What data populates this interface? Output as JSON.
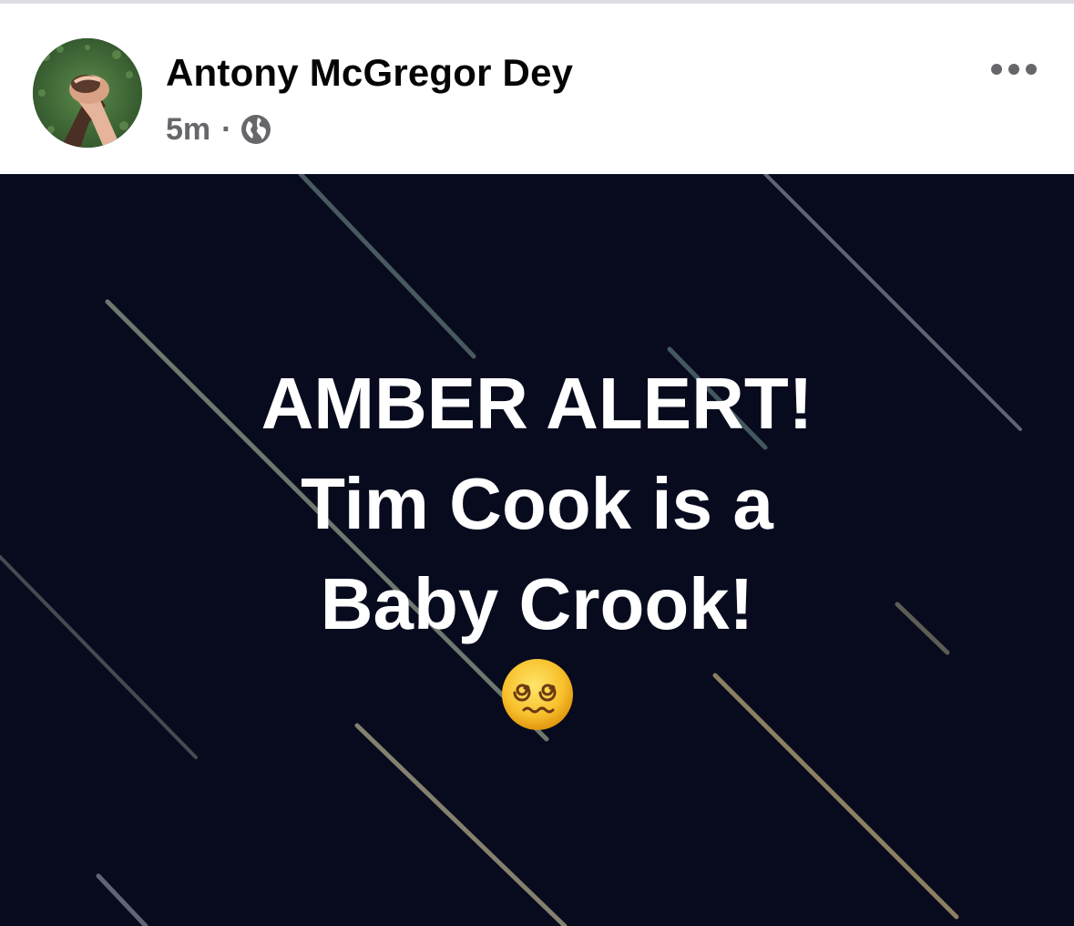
{
  "post": {
    "author": "Antony McGregor Dey",
    "timestamp": "5m",
    "separator": "·",
    "audience_icon": "globe-icon",
    "more_icon": "more-options-icon"
  },
  "image": {
    "text_lines": [
      "AMBER ALERT!",
      "Tim Cook is a",
      "Baby Crook!"
    ],
    "emoji": "face-with-spiral-eyes-icon",
    "background_color": "#080b1e",
    "text_color": "#ffffff"
  },
  "colors": {
    "name": "#050505",
    "meta": "#65676b"
  }
}
